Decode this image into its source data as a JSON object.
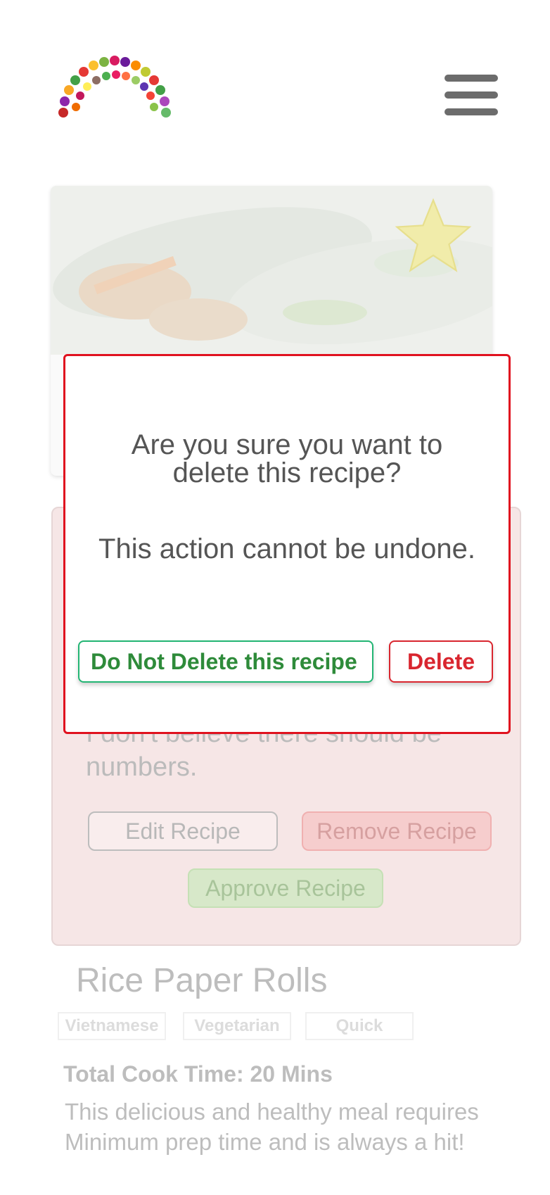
{
  "header": {
    "logo_icon": "fruit-rainbow-logo-icon",
    "menu_icon": "hamburger-menu-icon"
  },
  "recipe": {
    "favorite_icon": "star-icon",
    "admin_note": "I don't believe there should be numbers.",
    "buttons": {
      "edit": "Edit Recipe",
      "remove": "Remove Recipe",
      "approve": "Approve Recipe"
    },
    "title": "Rice Paper Rolls",
    "tags": [
      "Vietnamese",
      "Vegetarian",
      "Quick"
    ],
    "cook_time": "Total Cook Time: 20 Mins",
    "description": "This delicious and healthy meal requires Minimum prep time and is always a hit!"
  },
  "modal": {
    "question": "Are you sure you want to delete this recipe?",
    "warning": "This action cannot be undone.",
    "keep_label": "Do Not Delete this recipe",
    "delete_label": "Delete"
  },
  "colors": {
    "modal_border": "#e0121f",
    "keep_green": "#2e8b3a",
    "delete_red": "#d9262f",
    "admin_panel_bg": "#f6e6e6"
  }
}
